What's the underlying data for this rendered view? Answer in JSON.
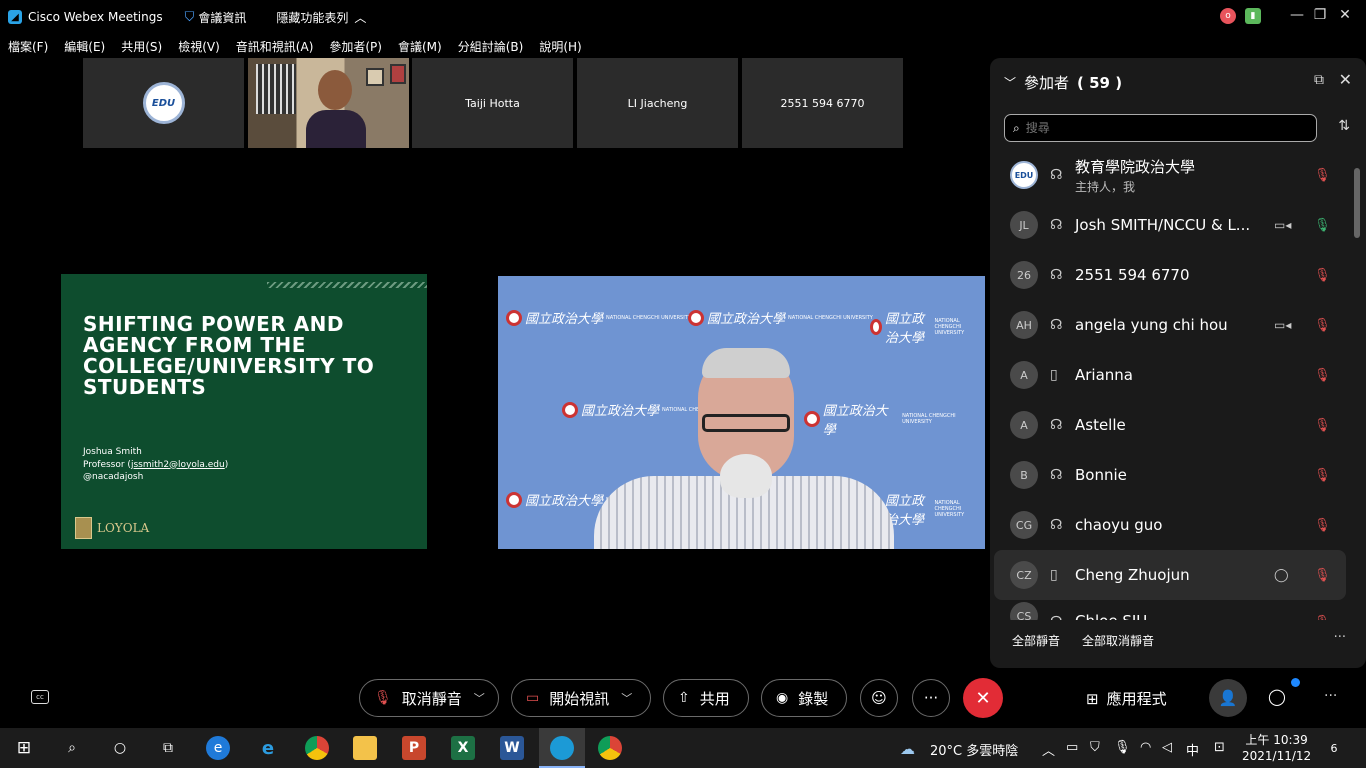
{
  "titlebar": {
    "app_name": "Cisco Webex Meetings",
    "meeting_info": "會議資訊",
    "hide_menu": "隱藏功能表列",
    "window_controls": {
      "minimize": "—",
      "maximize": "❐",
      "close": "✕"
    }
  },
  "menubar": [
    "檔案(F)",
    "編輯(E)",
    "共用(S)",
    "檢視(V)",
    "音訊和視訊(A)",
    "參加者(P)",
    "會議(M)",
    "分組討論(B)",
    "說明(H)"
  ],
  "thumbnails": [
    {
      "label": "",
      "kind": "logo"
    },
    {
      "label": "",
      "kind": "video"
    },
    {
      "label": "Taiji Hotta"
    },
    {
      "label": "LI Jiacheng"
    },
    {
      "label": "2551 594 6770"
    }
  ],
  "slide": {
    "headline": "SHIFTING POWER AND AGENCY FROM THE COLLEGE/UNIVERSITY TO STUDENTS",
    "presenter_name": "Joshua Smith",
    "presenter_role_prefix": "Professor (",
    "presenter_email": "jssmith2@loyola.edu",
    "presenter_role_suffix": ")",
    "presenter_handle": "@nacadajosh",
    "logo_text": "LOYOLA"
  },
  "main_video": {
    "backdrop_text": "NATIONAL CHENGCHI UNIVERSITY",
    "backdrop_calligraphy": "國立政治大學"
  },
  "participants_panel": {
    "title": "參加者",
    "count_text": "( 59 )",
    "search_placeholder": "搜尋",
    "participants": [
      {
        "initials": "EDU",
        "name": "教育學院政治大學",
        "sub": "主持人，我",
        "device": "headset",
        "camera": false,
        "muted": true
      },
      {
        "initials": "JL",
        "name": "Josh SMITH/NCCU & L...",
        "sub": "",
        "device": "headset",
        "camera": true,
        "muted": false
      },
      {
        "initials": "26",
        "name": "2551 594 6770",
        "sub": "",
        "device": "headset",
        "camera": false,
        "muted": true
      },
      {
        "initials": "AH",
        "name": "angela yung chi hou",
        "sub": "",
        "device": "headset",
        "camera": true,
        "muted": true
      },
      {
        "initials": "A",
        "name": "Arianna",
        "sub": "",
        "device": "phone",
        "camera": false,
        "muted": true
      },
      {
        "initials": "A",
        "name": "Astelle",
        "sub": "",
        "device": "headset",
        "camera": false,
        "muted": true
      },
      {
        "initials": "B",
        "name": "Bonnie",
        "sub": "",
        "device": "headset",
        "camera": false,
        "muted": true
      },
      {
        "initials": "CG",
        "name": "chaoyu guo",
        "sub": "",
        "device": "headset",
        "camera": false,
        "muted": true
      },
      {
        "initials": "CZ",
        "name": "Cheng Zhuojun",
        "sub": "",
        "device": "phone",
        "camera": false,
        "muted": true,
        "highlighted": true
      },
      {
        "initials": "CS",
        "name": "Chloe SIU",
        "sub": "",
        "device": "headset",
        "camera": false,
        "muted": true
      }
    ],
    "footer": {
      "mute_all": "全部靜音",
      "unmute_all": "全部取消靜音",
      "more": "···"
    }
  },
  "controls": {
    "unmute": "取消靜音",
    "start_video": "開始視訊",
    "share": "共用",
    "record": "錄製",
    "more": "···",
    "apps": "應用程式"
  },
  "taskbar": {
    "weather": "20°C  多雲時陰",
    "ime": "中",
    "time": "上午 10:39",
    "date": "2021/11/12",
    "notifications": "6"
  },
  "colors": {
    "end_call": "#e22c36",
    "slide_green": "#0e4d2e",
    "mute_red": "#e05050",
    "mic_on": "#3cb371"
  }
}
